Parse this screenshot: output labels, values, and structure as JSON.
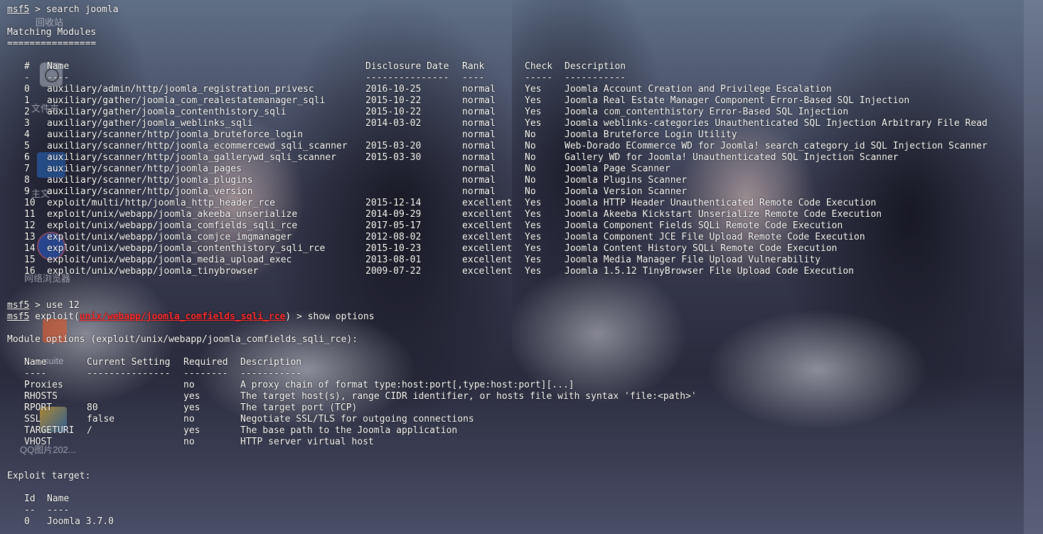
{
  "desktop": {
    "icons": [
      {
        "label": "回收站"
      },
      {
        "label": "文件夹"
      },
      {
        "label": "主文"
      },
      {
        "label": "网络浏览器"
      },
      {
        "label": "suite"
      },
      {
        "label": "QQ图片202..."
      }
    ]
  },
  "terminal": {
    "prompt": "msf5",
    "cmd_search": " > search joomla",
    "matching_title": "Matching Modules",
    "matching_rule": "================",
    "modules": {
      "headers": {
        "num": "#",
        "name": "Name",
        "date": "Disclosure Date",
        "rank": "Rank",
        "check": "Check",
        "desc": "Description"
      },
      "rules": {
        "num": "-",
        "name": "----",
        "date": "---------------",
        "rank": "----",
        "check": "-----",
        "desc": "-----------"
      },
      "rows": [
        {
          "num": "0",
          "name": "auxiliary/admin/http/joomla_registration_privesc",
          "date": "2016-10-25",
          "rank": "normal",
          "check": "Yes",
          "desc": "Joomla Account Creation and Privilege Escalation"
        },
        {
          "num": "1",
          "name": "auxiliary/gather/joomla_com_realestatemanager_sqli",
          "date": "2015-10-22",
          "rank": "normal",
          "check": "Yes",
          "desc": "Joomla Real Estate Manager Component Error-Based SQL Injection"
        },
        {
          "num": "2",
          "name": "auxiliary/gather/joomla_contenthistory_sqli",
          "date": "2015-10-22",
          "rank": "normal",
          "check": "Yes",
          "desc": "Joomla com_contenthistory Error-Based SQL Injection"
        },
        {
          "num": "3",
          "name": "auxiliary/gather/joomla_weblinks_sqli",
          "date": "2014-03-02",
          "rank": "normal",
          "check": "Yes",
          "desc": "Joomla weblinks-categories Unauthenticated SQL Injection Arbitrary File Read"
        },
        {
          "num": "4",
          "name": "auxiliary/scanner/http/joomla_bruteforce_login",
          "date": "",
          "rank": "normal",
          "check": "No",
          "desc": "Joomla Bruteforce Login Utility"
        },
        {
          "num": "5",
          "name": "auxiliary/scanner/http/joomla_ecommercewd_sqli_scanner",
          "date": "2015-03-20",
          "rank": "normal",
          "check": "No",
          "desc": "Web-Dorado ECommerce WD for Joomla! search_category_id SQL Injection Scanner"
        },
        {
          "num": "6",
          "name": "auxiliary/scanner/http/joomla_gallerywd_sqli_scanner",
          "date": "2015-03-30",
          "rank": "normal",
          "check": "No",
          "desc": "Gallery WD for Joomla! Unauthenticated SQL Injection Scanner"
        },
        {
          "num": "7",
          "name": "auxiliary/scanner/http/joomla_pages",
          "date": "",
          "rank": "normal",
          "check": "No",
          "desc": "Joomla Page Scanner"
        },
        {
          "num": "8",
          "name": "auxiliary/scanner/http/joomla_plugins",
          "date": "",
          "rank": "normal",
          "check": "No",
          "desc": "Joomla Plugins Scanner"
        },
        {
          "num": "9",
          "name": "auxiliary/scanner/http/joomla_version",
          "date": "",
          "rank": "normal",
          "check": "No",
          "desc": "Joomla Version Scanner"
        },
        {
          "num": "10",
          "name": "exploit/multi/http/joomla_http_header_rce",
          "date": "2015-12-14",
          "rank": "excellent",
          "check": "Yes",
          "desc": "Joomla HTTP Header Unauthenticated Remote Code Execution"
        },
        {
          "num": "11",
          "name": "exploit/unix/webapp/joomla_akeeba_unserialize",
          "date": "2014-09-29",
          "rank": "excellent",
          "check": "Yes",
          "desc": "Joomla Akeeba Kickstart Unserialize Remote Code Execution"
        },
        {
          "num": "12",
          "name": "exploit/unix/webapp/joomla_comfields_sqli_rce",
          "date": "2017-05-17",
          "rank": "excellent",
          "check": "Yes",
          "desc": "Joomla Component Fields SQLi Remote Code Execution"
        },
        {
          "num": "13",
          "name": "exploit/unix/webapp/joomla_comjce_imgmanager",
          "date": "2012-08-02",
          "rank": "excellent",
          "check": "Yes",
          "desc": "Joomla Component JCE File Upload Remote Code Execution"
        },
        {
          "num": "14",
          "name": "exploit/unix/webapp/joomla_contenthistory_sqli_rce",
          "date": "2015-10-23",
          "rank": "excellent",
          "check": "Yes",
          "desc": "Joomla Content History SQLi Remote Code Execution"
        },
        {
          "num": "15",
          "name": "exploit/unix/webapp/joomla_media_upload_exec",
          "date": "2013-08-01",
          "rank": "excellent",
          "check": "Yes",
          "desc": "Joomla Media Manager File Upload Vulnerability"
        },
        {
          "num": "16",
          "name": "exploit/unix/webapp/joomla_tinybrowser",
          "date": "2009-07-22",
          "rank": "excellent",
          "check": "Yes",
          "desc": "Joomla 1.5.12 TinyBrowser File Upload Code Execution"
        }
      ]
    },
    "cmd_use": " > use 12",
    "exploit_prefix": " exploit(",
    "exploit_module": "unix/webapp/joomla_comfields_sqli_rce",
    "exploit_suffix": ") > show options",
    "module_options_title": "Module options (exploit/unix/webapp/joomla_comfields_sqli_rce):",
    "options": {
      "headers": {
        "name": "Name",
        "setting": "Current Setting",
        "required": "Required",
        "desc": "Description"
      },
      "rules": {
        "name": "----",
        "setting": "---------------",
        "required": "--------",
        "desc": "-----------"
      },
      "rows": [
        {
          "name": "Proxies",
          "setting": "",
          "required": "no",
          "desc": "A proxy chain of format type:host:port[,type:host:port][...]"
        },
        {
          "name": "RHOSTS",
          "setting": "",
          "required": "yes",
          "desc": "The target host(s), range CIDR identifier, or hosts file with syntax 'file:<path>'"
        },
        {
          "name": "RPORT",
          "setting": "80",
          "required": "yes",
          "desc": "The target port (TCP)"
        },
        {
          "name": "SSL",
          "setting": "false",
          "required": "no",
          "desc": "Negotiate SSL/TLS for outgoing connections"
        },
        {
          "name": "TARGETURI",
          "setting": "/",
          "required": "yes",
          "desc": "The base path to the Joomla application"
        },
        {
          "name": "VHOST",
          "setting": "",
          "required": "no",
          "desc": "HTTP server virtual host"
        }
      ]
    },
    "exploit_target_title": "Exploit target:",
    "targets": {
      "headers": {
        "id": "Id",
        "name": "Name"
      },
      "rules": {
        "id": "--",
        "name": "----"
      },
      "rows": [
        {
          "id": "0",
          "name": "Joomla 3.7.0"
        }
      ]
    }
  }
}
